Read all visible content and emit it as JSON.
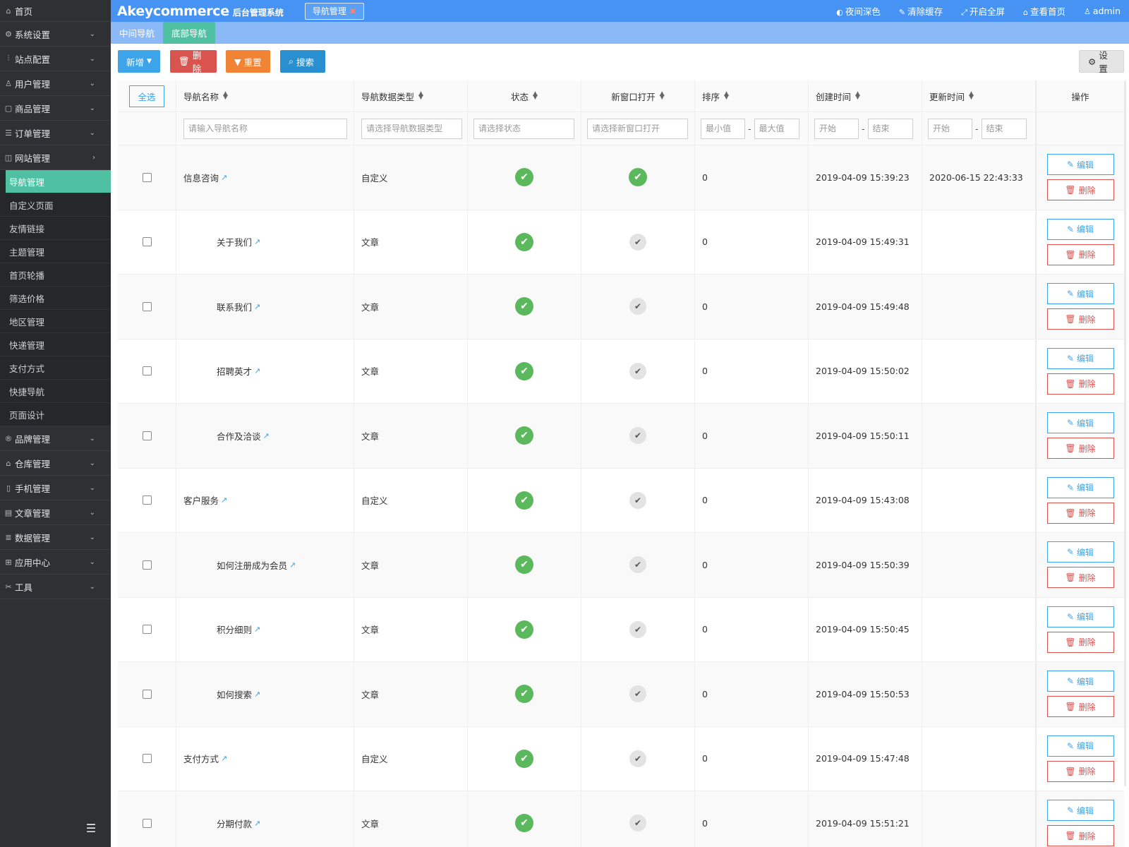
{
  "sidebar": {
    "home": "首页",
    "items_before": [
      {
        "label": "系统设置",
        "icon": "gear-icon"
      },
      {
        "label": "站点配置",
        "icon": "sliders-icon"
      },
      {
        "label": "用户管理",
        "icon": "user-icon"
      },
      {
        "label": "商品管理",
        "icon": "box-icon"
      },
      {
        "label": "订单管理",
        "icon": "list-icon"
      },
      {
        "label": "网站管理",
        "icon": "site-icon"
      }
    ],
    "sub_items": [
      "导航管理",
      "自定义页面",
      "友情链接",
      "主题管理",
      "首页轮播",
      "筛选价格",
      "地区管理",
      "快递管理",
      "支付方式",
      "快捷导航",
      "页面设计"
    ],
    "items_after": [
      {
        "label": "品牌管理",
        "icon": "brand-icon"
      },
      {
        "label": "仓库管理",
        "icon": "warehouse-icon"
      },
      {
        "label": "手机管理",
        "icon": "mobile-icon"
      },
      {
        "label": "文章管理",
        "icon": "article-icon"
      },
      {
        "label": "数据管理",
        "icon": "database-icon"
      },
      {
        "label": "应用中心",
        "icon": "apps-icon"
      },
      {
        "label": "工具",
        "icon": "tools-icon"
      }
    ]
  },
  "topbar": {
    "brand": "Akeycommerce",
    "brand_sub": "后台管理系统",
    "open_tab": "导航管理",
    "actions": [
      {
        "label": "夜间深色",
        "icon": "contrast-icon"
      },
      {
        "label": "清除缓存",
        "icon": "brush-icon"
      },
      {
        "label": "开启全屏",
        "icon": "fullscreen-icon"
      },
      {
        "label": "查看首页",
        "icon": "home-icon"
      },
      {
        "label": "admin",
        "icon": "user-icon"
      }
    ]
  },
  "subtabs": [
    "中间导航",
    "底部导航"
  ],
  "toolbar": {
    "new": "新增",
    "delete": "删除",
    "reset": "重置",
    "search": "搜索",
    "settings": "设置"
  },
  "table": {
    "select_all": "全选",
    "headers": {
      "name": "导航名称",
      "type": "导航数据类型",
      "status": "状态",
      "new_window": "新窗口打开",
      "sort": "排序",
      "created": "创建时间",
      "updated": "更新时间",
      "op": "操作"
    },
    "filters": {
      "name": "请输入导航名称",
      "type": "请选择导航数据类型",
      "status": "请选择状态",
      "new_window": "请选择新窗口打开",
      "sort_min": "最小值",
      "sort_max": "最大值",
      "created_start": "开始",
      "created_end": "结束",
      "updated_start": "开始",
      "updated_end": "结束",
      "range_sep": "-"
    },
    "op_edit": "编辑",
    "op_delete": "删除",
    "rows": [
      {
        "name": "信息咨询",
        "child": false,
        "type": "自定义",
        "status": true,
        "new_window": true,
        "sort": "0",
        "created": "2019-04-09 15:39:23",
        "updated": "2020-06-15 22:43:33"
      },
      {
        "name": "关于我们",
        "child": true,
        "type": "文章",
        "status": true,
        "new_window": false,
        "sort": "0",
        "created": "2019-04-09 15:49:31",
        "updated": ""
      },
      {
        "name": "联系我们",
        "child": true,
        "type": "文章",
        "status": true,
        "new_window": false,
        "sort": "0",
        "created": "2019-04-09 15:49:48",
        "updated": ""
      },
      {
        "name": "招聘英才",
        "child": true,
        "type": "文章",
        "status": true,
        "new_window": false,
        "sort": "0",
        "created": "2019-04-09 15:50:02",
        "updated": ""
      },
      {
        "name": "合作及洽谈",
        "child": true,
        "type": "文章",
        "status": true,
        "new_window": false,
        "sort": "0",
        "created": "2019-04-09 15:50:11",
        "updated": ""
      },
      {
        "name": "客户服务",
        "child": false,
        "type": "自定义",
        "status": true,
        "new_window": false,
        "sort": "0",
        "created": "2019-04-09 15:43:08",
        "updated": ""
      },
      {
        "name": "如何注册成为会员",
        "child": true,
        "type": "文章",
        "status": true,
        "new_window": false,
        "sort": "0",
        "created": "2019-04-09 15:50:39",
        "updated": ""
      },
      {
        "name": "积分细则",
        "child": true,
        "type": "文章",
        "status": true,
        "new_window": false,
        "sort": "0",
        "created": "2019-04-09 15:50:45",
        "updated": ""
      },
      {
        "name": "如何搜索",
        "child": true,
        "type": "文章",
        "status": true,
        "new_window": false,
        "sort": "0",
        "created": "2019-04-09 15:50:53",
        "updated": ""
      },
      {
        "name": "支付方式",
        "child": false,
        "type": "自定义",
        "status": true,
        "new_window": false,
        "sort": "0",
        "created": "2019-04-09 15:47:48",
        "updated": ""
      },
      {
        "name": "分期付款",
        "child": true,
        "type": "文章",
        "status": true,
        "new_window": false,
        "sort": "0",
        "created": "2019-04-09 15:51:21",
        "updated": ""
      }
    ]
  },
  "colors": {
    "primary": "#4693f4",
    "accent": "#4fc0a2",
    "danger": "#d9534f",
    "warning": "#f18434",
    "success": "#5cb85c"
  }
}
